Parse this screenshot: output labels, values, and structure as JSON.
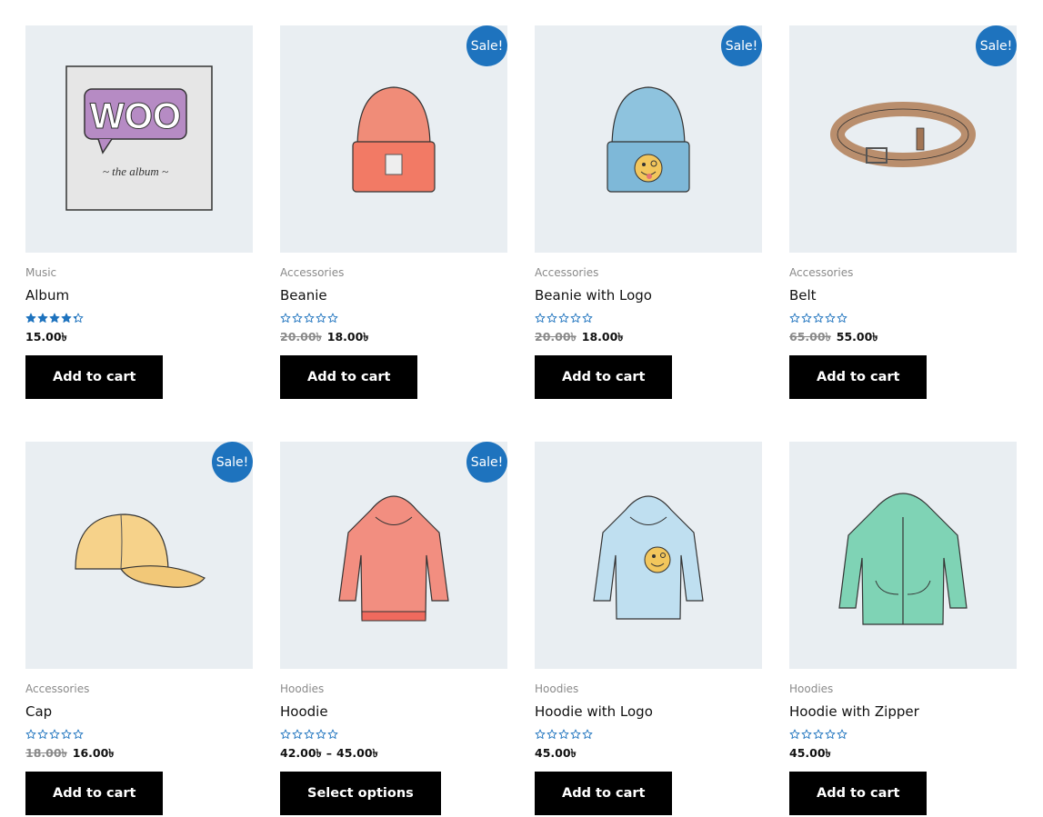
{
  "currency_symbol": "৳",
  "colors": {
    "sale_badge": "#1e73be",
    "button_bg": "#000000",
    "star": "#1e73be",
    "thumb_bg": "#e9eef2"
  },
  "products": [
    {
      "category": "Music",
      "name": "Album",
      "rating": 4.3,
      "sale": false,
      "sale_label": "Sale!",
      "price_old": "",
      "price": "15.00৳",
      "price_range_to": "",
      "button": "Add to cart",
      "image": "album"
    },
    {
      "category": "Accessories",
      "name": "Beanie",
      "rating": 0,
      "sale": true,
      "sale_label": "Sale!",
      "price_old": "20.00৳",
      "price": "18.00৳",
      "price_range_to": "",
      "button": "Add to cart",
      "image": "beanie"
    },
    {
      "category": "Accessories",
      "name": "Beanie with Logo",
      "rating": 0,
      "sale": true,
      "sale_label": "Sale!",
      "price_old": "20.00৳",
      "price": "18.00৳",
      "price_range_to": "",
      "button": "Add to cart",
      "image": "beanie-logo"
    },
    {
      "category": "Accessories",
      "name": "Belt",
      "rating": 0,
      "sale": true,
      "sale_label": "Sale!",
      "price_old": "65.00৳",
      "price": "55.00৳",
      "price_range_to": "",
      "button": "Add to cart",
      "image": "belt"
    },
    {
      "category": "Accessories",
      "name": "Cap",
      "rating": 0,
      "sale": true,
      "sale_label": "Sale!",
      "price_old": "18.00৳",
      "price": "16.00৳",
      "price_range_to": "",
      "button": "Add to cart",
      "image": "cap"
    },
    {
      "category": "Hoodies",
      "name": "Hoodie",
      "rating": 0,
      "sale": true,
      "sale_label": "Sale!",
      "price_old": "",
      "price": "42.00৳",
      "price_range_to": "45.00৳",
      "button": "Select options",
      "image": "hoodie"
    },
    {
      "category": "Hoodies",
      "name": "Hoodie with Logo",
      "rating": 0,
      "sale": false,
      "sale_label": "Sale!",
      "price_old": "",
      "price": "45.00৳",
      "price_range_to": "",
      "button": "Add to cart",
      "image": "hoodie-logo"
    },
    {
      "category": "Hoodies",
      "name": "Hoodie with Zipper",
      "rating": 0,
      "sale": false,
      "sale_label": "Sale!",
      "price_old": "",
      "price": "45.00৳",
      "price_range_to": "",
      "button": "Add to cart",
      "image": "hoodie-zipper"
    }
  ]
}
